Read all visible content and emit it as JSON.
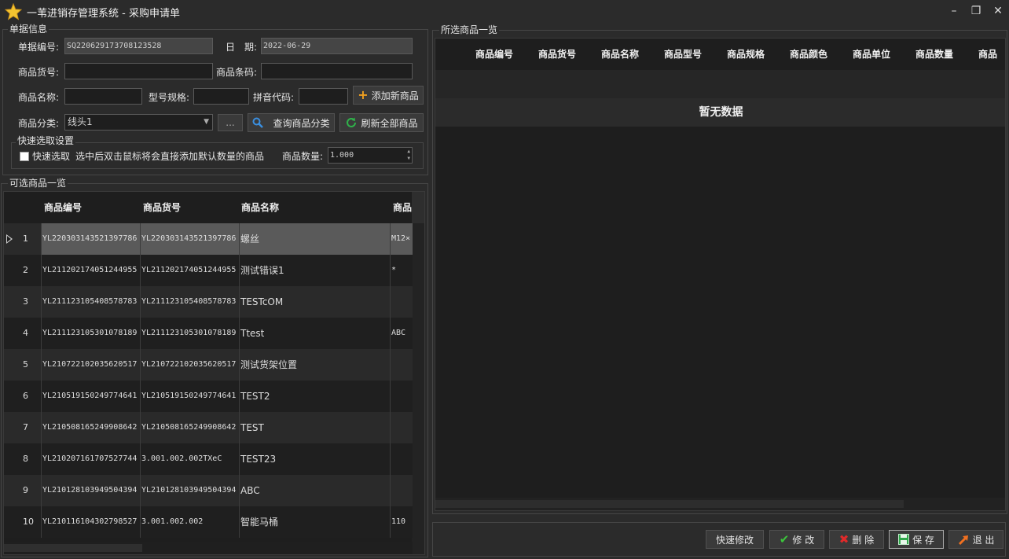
{
  "window": {
    "title": "一苇进销存管理系统 - 采购申请单",
    "min": "–",
    "max": "❐",
    "close": "✕"
  },
  "form": {
    "group_label": "单据信息",
    "doc_no_label": "单据编号:",
    "doc_no_value": "SQ220629173708123528",
    "date_label": "日　期:",
    "date_value": "2022-06-29",
    "goods_code_label": "商品货号:",
    "goods_code_value": "",
    "barcode_label": "商品条码:",
    "barcode_value": "",
    "goods_name_label": "商品名称:",
    "goods_name_value": "",
    "model_label": "型号规格:",
    "model_value": "",
    "pinyin_label": "拼音代码:",
    "pinyin_value": "",
    "add_button": "添加新商品",
    "category_label": "商品分类:",
    "category_value": "线头1",
    "dots_button": "...",
    "query_button": "查询商品分类",
    "refresh_button": "刷新全部商品"
  },
  "quick": {
    "group_label": "快速选取设置",
    "checkbox_label": "快速选取",
    "hint": "选中后双击鼠标将会直接添加默认数量的商品",
    "qty_label": "商品数量:",
    "qty_value": "1.000",
    "spin_up": "▲",
    "spin_down": "▼"
  },
  "left_grid": {
    "group_label": "可选商品一览",
    "headers": [
      "商品编号",
      "商品货号",
      "商品名称",
      "商品"
    ],
    "rows": [
      {
        "idx": "1",
        "code": "YL220303143521397786",
        "sku": "YL220303143521397786",
        "name": "螺丝",
        "spec": "M12×"
      },
      {
        "idx": "2",
        "code": "YL211202174051244955",
        "sku": "YL211202174051244955",
        "name": "测试错误1",
        "spec": "*"
      },
      {
        "idx": "3",
        "code": "YL211123105408578783",
        "sku": "YL211123105408578783",
        "name": "TESTcOM",
        "spec": ""
      },
      {
        "idx": "4",
        "code": "YL211123105301078189",
        "sku": "YL211123105301078189",
        "name": "Ttest",
        "spec": "ABC"
      },
      {
        "idx": "5",
        "code": "YL210722102035620517",
        "sku": "YL210722102035620517",
        "name": "测试货架位置",
        "spec": ""
      },
      {
        "idx": "6",
        "code": "YL210519150249774641",
        "sku": "YL210519150249774641",
        "name": "TEST2",
        "spec": ""
      },
      {
        "idx": "7",
        "code": "YL210508165249908642",
        "sku": "YL210508165249908642",
        "name": "TEST",
        "spec": ""
      },
      {
        "idx": "8",
        "code": "YL210207161707527744",
        "sku": "3.001.002.002TXeC",
        "name": "TEST23",
        "spec": ""
      },
      {
        "idx": "9",
        "code": "YL210128103949504394",
        "sku": "YL210128103949504394",
        "name": "ABC",
        "spec": ""
      },
      {
        "idx": "10",
        "code": "YL210116104302798527",
        "sku": "3.001.002.002",
        "name": "智能马桶",
        "spec": "110"
      }
    ]
  },
  "right_grid": {
    "group_label": "所选商品一览",
    "headers": [
      "商品编号",
      "商品货号",
      "商品名称",
      "商品型号",
      "商品规格",
      "商品颜色",
      "商品单位",
      "商品数量",
      "商品"
    ],
    "empty_text": "暂无数据"
  },
  "actions": {
    "quick_edit": "快速修改",
    "edit": "修 改",
    "delete": "删 除",
    "save": "保 存",
    "exit": "退 出"
  },
  "colors": {
    "accent_orange": "#f0a020",
    "search_blue": "#3a8fe0",
    "refresh_green": "#2fb24a",
    "check_green": "#3cc43c",
    "delete_red": "#e02a2a"
  }
}
